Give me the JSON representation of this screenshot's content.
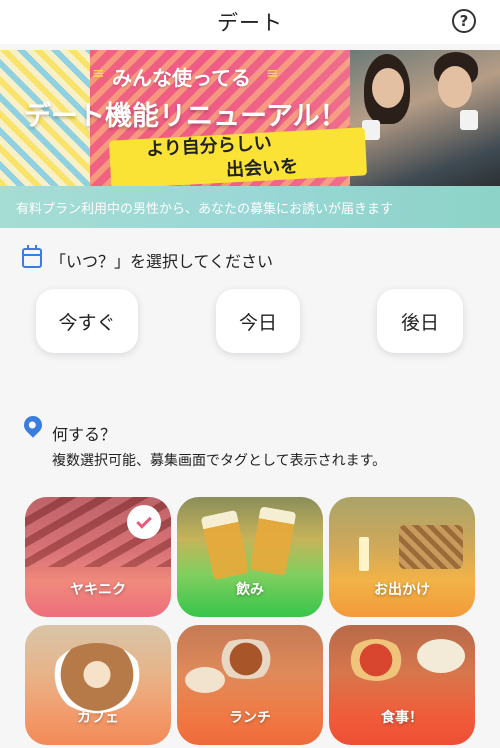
{
  "header": {
    "title": "デート",
    "help_icon": "question-circle-icon",
    "help_glyph": "?"
  },
  "banner": {
    "subtitle": "みんな使ってる",
    "title": "デート機能リニューアル！",
    "handwritten_line1": "より自分らしい",
    "handwritten_line2": "出会いを"
  },
  "info_strip": {
    "text": "有料プラン利用中の男性から、あなたの募集にお誘いが届きます"
  },
  "when_section": {
    "icon": "calendar-icon",
    "label": "「いつ？」を選択してください",
    "options": [
      "今すぐ",
      "今日",
      "後日"
    ]
  },
  "what_section": {
    "icon": "location-pin-icon",
    "label": "何する？",
    "sublabel": "複数選択可能、募集画面でタグとして表示されます。"
  },
  "activities": [
    {
      "label": "ヤキニク",
      "selected": true
    },
    {
      "label": "飲み",
      "selected": false
    },
    {
      "label": "お出かけ",
      "selected": false
    },
    {
      "label": "カフェ",
      "selected": false
    },
    {
      "label": "ランチ",
      "selected": false
    },
    {
      "label": "食事！",
      "selected": false
    }
  ],
  "colors": {
    "accent_blue": "#3b7ddf",
    "banner_pink": "#ef5b86",
    "strip_teal": "#9ad7d6",
    "check_pink": "#e75b7a"
  }
}
